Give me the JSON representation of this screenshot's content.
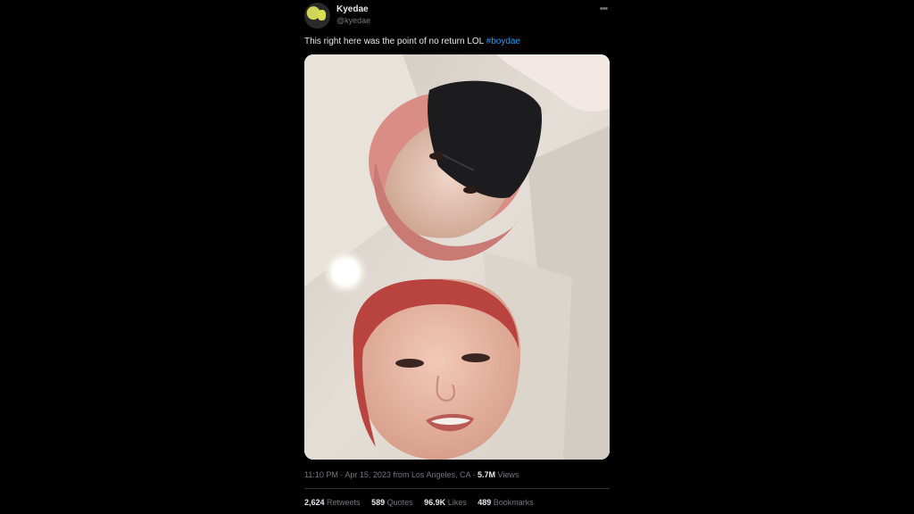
{
  "user": {
    "display_name": "Kyedae",
    "handle": "@kyedae"
  },
  "tweet": {
    "text": "This right here was the point of no return LOL ",
    "hashtag": "#boydae"
  },
  "meta": {
    "time": "11:10 PM",
    "separator1": " · ",
    "date": "Apr 15, 2023",
    "location": " from Los Angeles, CA",
    "separator2": " · ",
    "views_count": "5.7M",
    "views_label": " Views"
  },
  "stats": [
    {
      "num": "2,624",
      "label": " Retweets"
    },
    {
      "num": "589",
      "label": " Quotes"
    },
    {
      "num": "96.9K",
      "label": " Likes"
    },
    {
      "num": "489",
      "label": " Bookmarks"
    }
  ],
  "icons": {
    "more": "more-horizontal-icon"
  },
  "colors": {
    "background": "#000000",
    "text": "#e7e9ea",
    "secondary": "#71767b",
    "accent": "#1d9bf0"
  }
}
